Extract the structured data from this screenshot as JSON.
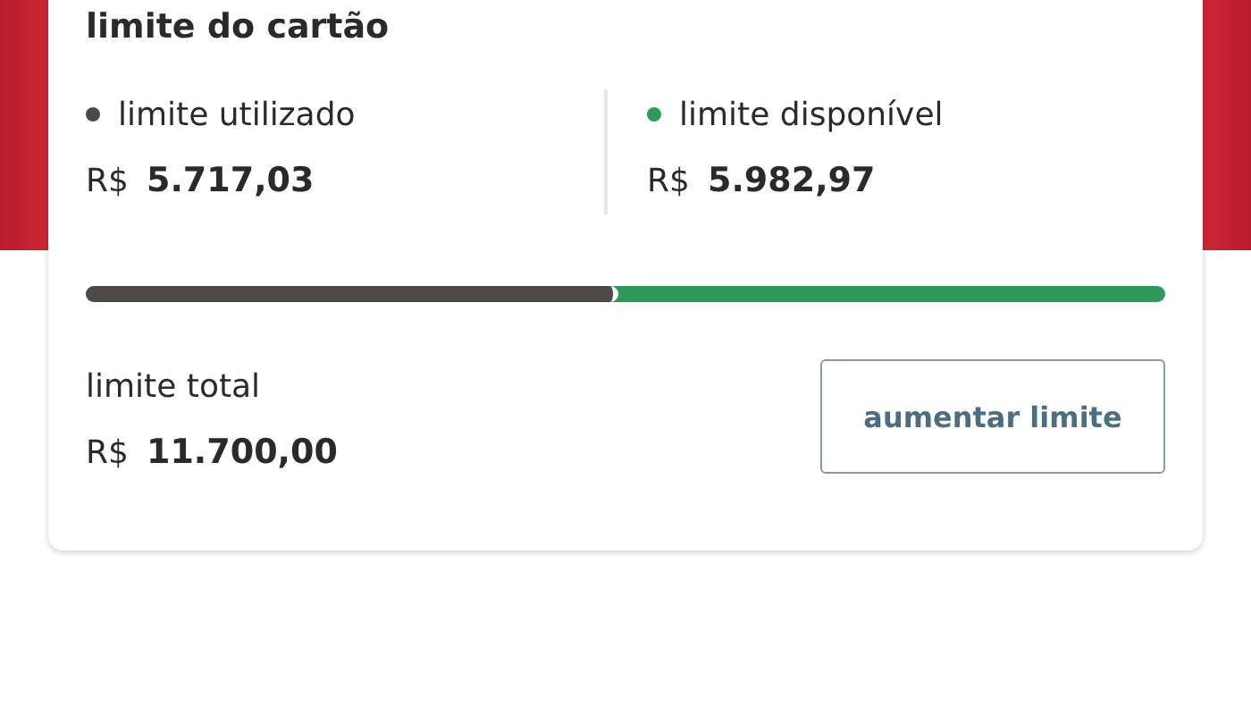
{
  "card": {
    "title": "limite do cartão",
    "limits": [
      {
        "label": "limite utilizado",
        "currency": "R$",
        "amount": "5.717,03",
        "color": "#4f4a48"
      },
      {
        "label": "limite disponível",
        "currency": "R$",
        "amount": "5.982,97",
        "color": "#2e9a5a"
      }
    ],
    "usage_bar": {
      "level": 0.489
    },
    "total": {
      "label": "limite total",
      "currency": "R$",
      "amount": "11.700,00"
    },
    "button": "aumentar limite"
  }
}
